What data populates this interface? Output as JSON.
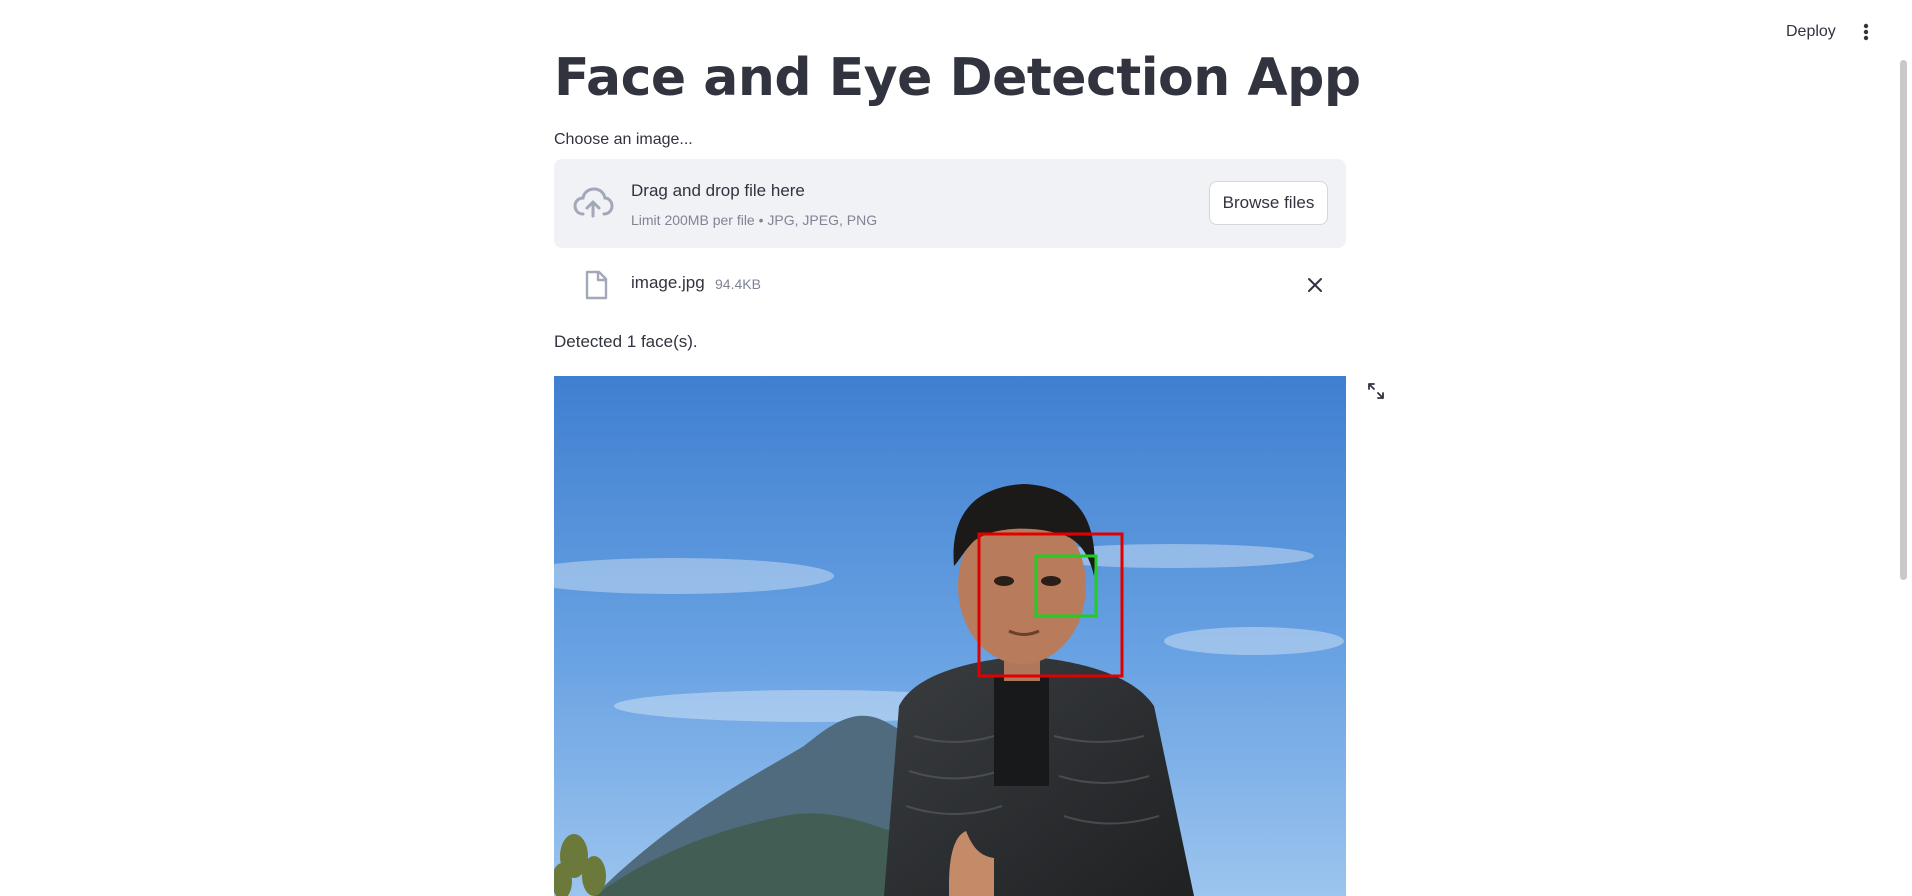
{
  "header": {
    "deploy_label": "Deploy",
    "menu_icon": "kebab-menu-icon"
  },
  "main": {
    "title": "Face and Eye Detection App",
    "uploader": {
      "label": "Choose an image...",
      "drop_title": "Drag and drop file here",
      "drop_subtitle": "Limit 200MB per file • JPG, JPEG, PNG",
      "browse_label": "Browse files",
      "upload_icon": "cloud-upload-icon"
    },
    "uploaded_file": {
      "name": "image.jpg",
      "size": "94.4KB",
      "file_icon": "file-icon",
      "remove_icon": "close-icon"
    },
    "result_text": "Detected 1 face(s).",
    "fullscreen_icon": "fullscreen-icon"
  },
  "colors": {
    "text": "#31333f",
    "muted": "#808495",
    "dropzone_bg": "#f0f2f6",
    "face_box": "#e00000",
    "eye_box": "#22cc22",
    "sky": "#4a8ad6"
  }
}
